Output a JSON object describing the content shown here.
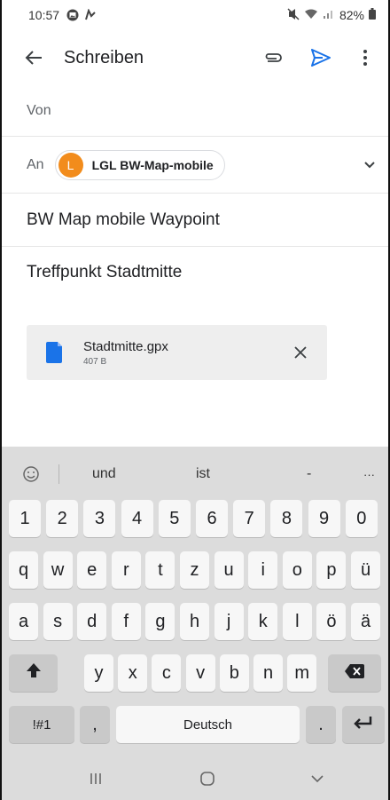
{
  "status_bar": {
    "time": "10:57",
    "battery": "82%"
  },
  "app_bar": {
    "title": "Schreiben"
  },
  "compose": {
    "from_label": "Von",
    "to_label": "An",
    "recipient": {
      "initial": "L",
      "name": "LGL BW-Map-mobile",
      "avatar_color": "#f28c1c"
    },
    "subject": "BW Map mobile Waypoint",
    "body": "Treffpunkt Stadtmitte"
  },
  "attachment": {
    "filename": "Stadtmitte.gpx",
    "size": "407 B"
  },
  "keyboard": {
    "suggestions": [
      "und",
      "ist",
      "-",
      "···"
    ],
    "row_numbers": [
      "1",
      "2",
      "3",
      "4",
      "5",
      "6",
      "7",
      "8",
      "9",
      "0"
    ],
    "row1": [
      "q",
      "w",
      "e",
      "r",
      "t",
      "z",
      "u",
      "i",
      "o",
      "p",
      "ü"
    ],
    "row2": [
      "a",
      "s",
      "d",
      "f",
      "g",
      "h",
      "j",
      "k",
      "l",
      "ö",
      "ä"
    ],
    "row3": [
      "y",
      "x",
      "c",
      "v",
      "b",
      "n",
      "m"
    ],
    "symbols_label": "!#1",
    "comma": ",",
    "space_label": "Deutsch",
    "period": "."
  },
  "colors": {
    "send_icon": "#1a73e8",
    "keyboard_bg": "#dcdcdc"
  },
  "icons": [
    "signal-icon",
    "battery-icon",
    "back-arrow-icon",
    "attach-icon",
    "send-icon",
    "more-vert-icon",
    "chevron-down-icon",
    "file-icon",
    "close-icon",
    "emoji-icon",
    "shift-icon",
    "backspace-icon",
    "enter-icon",
    "recents-icon",
    "home-icon",
    "back-icon"
  ]
}
